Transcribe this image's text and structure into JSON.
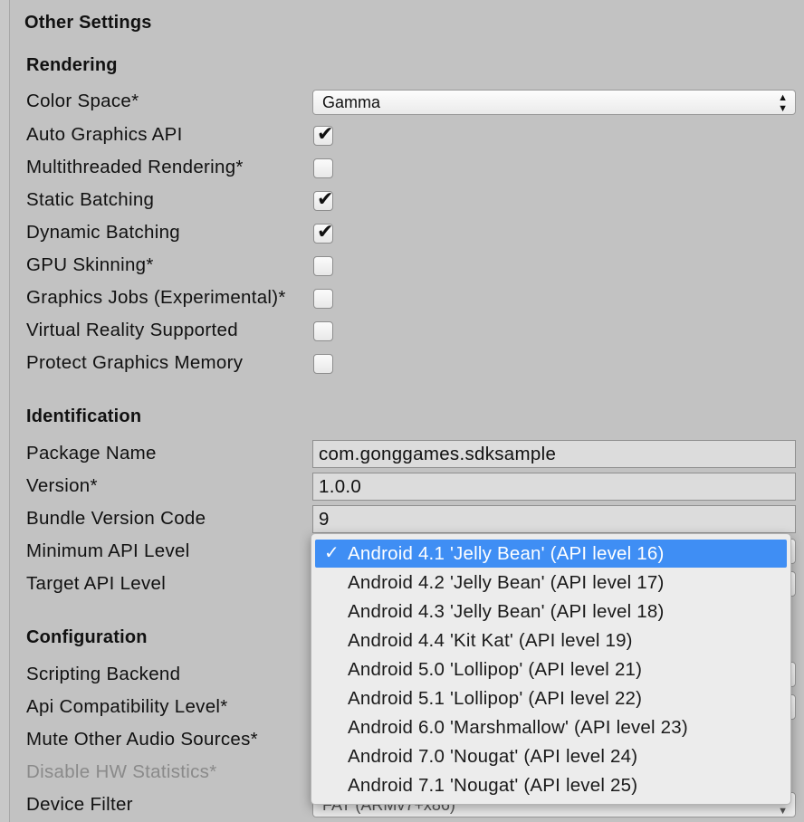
{
  "header": {
    "title": "Other Settings"
  },
  "rendering": {
    "title": "Rendering",
    "color_space": {
      "label": "Color Space*",
      "value": "Gamma"
    },
    "checkboxes": [
      {
        "label": "Auto Graphics API",
        "checked": true
      },
      {
        "label": "Multithreaded Rendering*",
        "checked": false
      },
      {
        "label": "Static Batching",
        "checked": true
      },
      {
        "label": "Dynamic Batching",
        "checked": true
      },
      {
        "label": "GPU Skinning*",
        "checked": false
      },
      {
        "label": "Graphics Jobs (Experimental)*",
        "checked": false
      },
      {
        "label": "Virtual Reality Supported",
        "checked": false
      },
      {
        "label": "Protect Graphics Memory",
        "checked": false
      }
    ]
  },
  "identification": {
    "title": "Identification",
    "package_name": {
      "label": "Package Name",
      "value": "com.gonggames.sdksample"
    },
    "version": {
      "label": "Version*",
      "value": "1.0.0"
    },
    "bundle_version_code": {
      "label": "Bundle Version Code",
      "value": "9"
    },
    "minimum_api_level": {
      "label": "Minimum API Level"
    },
    "target_api_level": {
      "label": "Target API Level"
    }
  },
  "configuration": {
    "title": "Configuration",
    "scripting_backend": {
      "label": "Scripting Backend"
    },
    "api_compatibility_level": {
      "label": "Api Compatibility Level*"
    },
    "mute_other_audio_sources": {
      "label": "Mute Other Audio Sources*"
    },
    "disable_hw_statistics": {
      "label": "Disable HW Statistics*",
      "disabled": true
    },
    "device_filter": {
      "label": "Device Filter",
      "partial_value": "FAT (ARMv7+x86)"
    }
  },
  "api_dropdown": {
    "selected_index": 0,
    "check_glyph": "✓",
    "options": [
      "Android 4.1 'Jelly Bean' (API level 16)",
      "Android 4.2 'Jelly Bean' (API level 17)",
      "Android 4.3 'Jelly Bean' (API level 18)",
      "Android 4.4 'Kit Kat' (API level 19)",
      "Android 5.0 'Lollipop' (API level 21)",
      "Android 5.1 'Lollipop' (API level 22)",
      "Android 6.0 'Marshmallow' (API level 23)",
      "Android 7.0 'Nougat' (API level 24)",
      "Android 7.1 'Nougat' (API level 25)"
    ]
  },
  "colors": {
    "selection": "#3f8ef4",
    "panel_bg": "#c2c2c2",
    "disabled_text": "#8a8a8a"
  }
}
